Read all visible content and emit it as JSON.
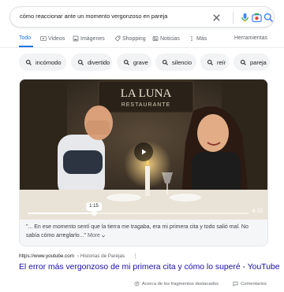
{
  "search": {
    "query": "cómo reaccionar ante un momento vergonzoso en pareja"
  },
  "tabs": [
    {
      "label": "Todo",
      "icon": "none",
      "active": true
    },
    {
      "label": "Videos",
      "icon": "play-icon"
    },
    {
      "label": "Imágenes",
      "icon": "image-icon"
    },
    {
      "label": "Shopping",
      "icon": "tag-icon"
    },
    {
      "label": "Noticias",
      "icon": "news-icon"
    },
    {
      "label": "Más",
      "icon": "more-vert-icon"
    },
    {
      "label": "Herramientas",
      "icon": "none"
    }
  ],
  "chips": [
    {
      "label": "incómodo"
    },
    {
      "label": "divertido"
    },
    {
      "label": "grave"
    },
    {
      "label": "silencio"
    },
    {
      "label": "reír"
    },
    {
      "label": "pareja"
    }
  ],
  "video": {
    "sign_line1": "LA LUNA",
    "sign_line2": "RESTAURANTE",
    "current_time": "1:15",
    "duration": "4:10",
    "progress": 0.3
  },
  "snippet": {
    "text": "\"... En ese momento sentí que la tierra me tragaba, era mi primera cita y todo salió mal. No sabía cómo arreglarlo...\"",
    "more_label": "More"
  },
  "result": {
    "url": "https://www.youtube.com",
    "breadcrumb": "› Historias de Parejas",
    "title": "El error más vergonzoso de mi primera cita y cómo lo superé - YouTube"
  },
  "footer": {
    "about_label": "Acerca de los fragmentos destacados",
    "feedback_label": "Comentarios"
  },
  "colors": {
    "accent": "#1a73e8",
    "link": "#1a0dab",
    "chip_bg": "#f1f3f4"
  }
}
